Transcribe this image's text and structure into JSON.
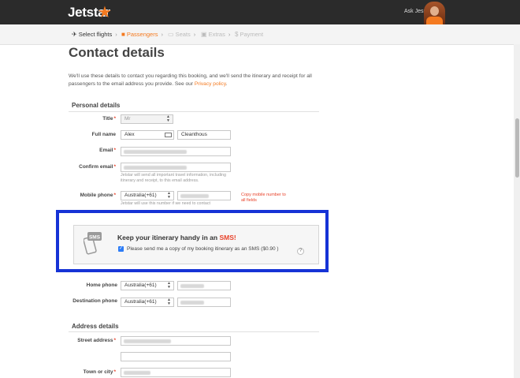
{
  "header": {
    "logo_text": "Jetstar",
    "ask_label": "Ask Jess"
  },
  "breadcrumbs": [
    {
      "label": "Select flights",
      "state": "done",
      "icon": "plane-icon"
    },
    {
      "label": "Passengers",
      "state": "active",
      "icon": "person-icon"
    },
    {
      "label": "Seats",
      "state": "upcoming",
      "icon": "seat-icon"
    },
    {
      "label": "Extras",
      "state": "upcoming",
      "icon": "bus-icon"
    },
    {
      "label": "Payment",
      "state": "upcoming",
      "icon": "dollar-icon"
    }
  ],
  "page": {
    "title": "Contact details",
    "intro": "We'll use these details to contact you regarding this booking, and we'll send the itinerary and receipt for all passengers to the email address you provide. See our",
    "privacy_link": "Privacy policy",
    "intro_end": "."
  },
  "personal": {
    "section_title": "Personal details",
    "title_label": "Title",
    "title_value": "Mr",
    "fullname_label": "Full name",
    "first_name": "Alex",
    "last_name": "Cleanthous",
    "email_label": "Email",
    "confirm_email_label": "Confirm email",
    "email_help": "Jetstar will send all important travel information, including itinerary and receipt, to this email address.",
    "mobile_label": "Mobile phone",
    "mobile_country": "Australia(+61)",
    "mobile_help": "Jetstar will use this number if we need to contact",
    "copy_mobile_link": "Copy mobile number to all fields"
  },
  "sms": {
    "title_prefix": "Keep your itinerary handy in an",
    "title_highlight": "SMS!",
    "checkbox_label": "Please send me a copy of my booking itinerary as an SMS ($0.90 )",
    "checked": true,
    "help_glyph": "?",
    "icon_text": "SMS"
  },
  "phones": {
    "home_label": "Home phone",
    "home_country": "Australia(+61)",
    "destination_label": "Destination phone",
    "destination_country": "Australia(+61)"
  },
  "address": {
    "section_title": "Address details",
    "street_label": "Street address",
    "town_label": "Town or city"
  },
  "colors": {
    "accent": "#f47a20",
    "required": "#e8432b",
    "highlight_border": "#1633d6",
    "topbar": "#2b2b2b"
  }
}
